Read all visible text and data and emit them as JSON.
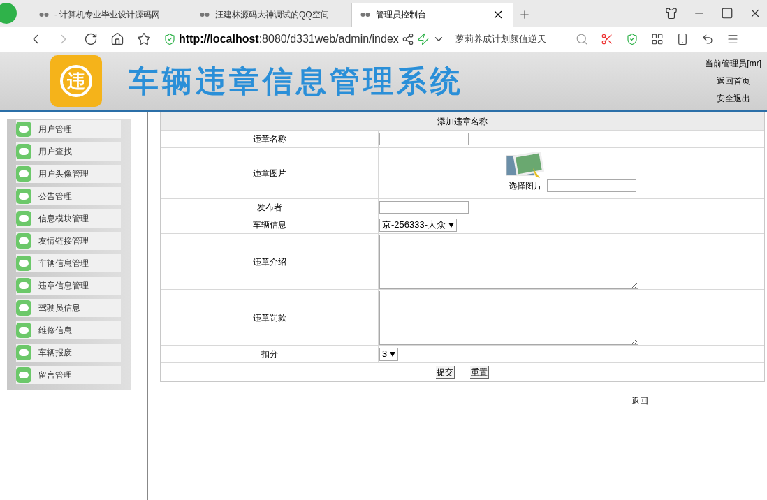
{
  "browser": {
    "tabs": [
      {
        "title": "- 计算机专业毕业设计源码网",
        "selected": false
      },
      {
        "title": "汪建林源码大神调试的QQ空间",
        "selected": false
      },
      {
        "title": "管理员控制台",
        "selected": true
      }
    ],
    "address": {
      "host": "http://localhost",
      "path": ":8080/d331web/admin/index"
    },
    "search": {
      "value": "萝莉养成计划颜值逆天"
    }
  },
  "header": {
    "logo": "违",
    "title": "车辆违章信息管理系统",
    "user": "当前管理员[mr]",
    "links": [
      "返回首页",
      "安全退出"
    ]
  },
  "sidebar": {
    "items": [
      {
        "label": "用户管理"
      },
      {
        "label": "用户查找"
      },
      {
        "label": "用户头像管理"
      },
      {
        "label": "公告管理"
      },
      {
        "label": "信息模块管理"
      },
      {
        "label": "友情链接管理"
      },
      {
        "label": "车辆信息管理"
      },
      {
        "label": "违章信息管理"
      },
      {
        "label": "驾驶员信息"
      },
      {
        "label": "维修信息"
      },
      {
        "label": "车辆报废"
      },
      {
        "label": "留言管理"
      }
    ]
  },
  "form": {
    "title": "添加违章名称",
    "rows": [
      {
        "label": "违章名称",
        "kind": "text"
      },
      {
        "label": "违章图片",
        "kind": "image",
        "caption": "选择图片"
      },
      {
        "label": "发布者",
        "kind": "text"
      },
      {
        "label": "车辆信息",
        "kind": "select",
        "value": "京-256333-大众"
      },
      {
        "label": "违章介绍",
        "kind": "textarea"
      },
      {
        "label": "违章罚款",
        "kind": "textarea"
      },
      {
        "label": "扣分",
        "kind": "select",
        "value": "3"
      }
    ],
    "buttons": [
      "提交",
      "重置"
    ],
    "back_link": "返回"
  }
}
